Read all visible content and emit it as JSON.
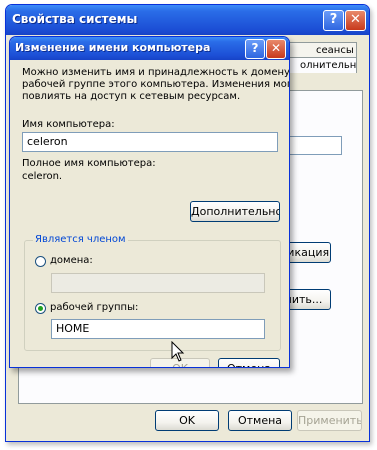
{
  "back_window": {
    "title": "Свойства системы",
    "tabs_right": [
      "сеансы",
      "олнительно"
    ],
    "buttons": {
      "ok": "OK",
      "cancel": "Отмена",
      "apply": "Применить"
    },
    "partial_buttons": {
      "identify": "фикация",
      "change": "нить..."
    }
  },
  "dialog": {
    "title": "Изменение имени компьютера",
    "help_glyph": "?",
    "close_glyph": "✕",
    "description": [
      "Можно изменить имя и принадлежность к домену или",
      "рабочей группе этого компьютера. Изменения могут",
      "повлиять на доступ к сетевым ресурсам."
    ],
    "computer_name_label": "Имя компьютера:",
    "computer_name_value": "celeron",
    "full_name_label": "Полное имя компьютера:",
    "full_name_value": "celeron.",
    "more_button": "Дополнительно...",
    "member_of": {
      "legend": "Является членом",
      "domain_label": "домена:",
      "domain_value": "",
      "workgroup_label": "рабочей группы:",
      "workgroup_value": "HOME",
      "selected": "workgroup"
    },
    "ok_button": "OK",
    "cancel_button": "Отмена"
  },
  "colors": {
    "title_blue": "#1c4fd6",
    "dialog_bg": "#ece9d8",
    "legend_blue": "#0046d5"
  }
}
